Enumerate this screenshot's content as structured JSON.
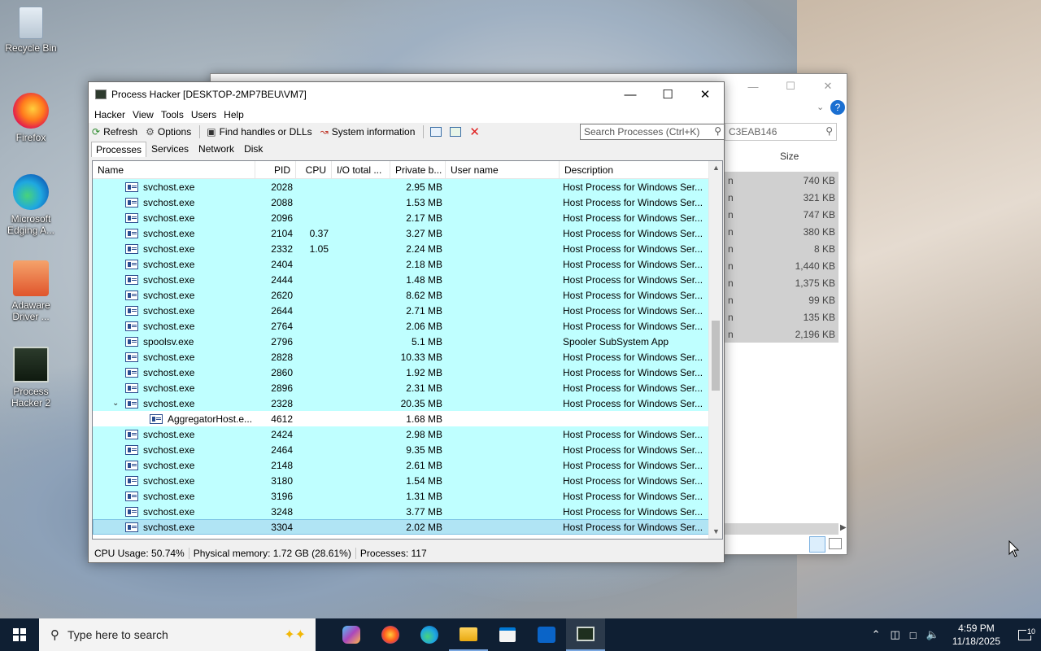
{
  "desktop": {
    "icons": [
      {
        "label": "Recycle Bin"
      },
      {
        "label": "Firefox"
      },
      {
        "label": "Microsoft Edging A..."
      },
      {
        "label": "Adaware Driver ..."
      },
      {
        "label": "Process Hacker 2"
      }
    ]
  },
  "bg_window": {
    "search_text": "C3EAB146",
    "size_header": "Size",
    "sizes": [
      "740 KB",
      "321 KB",
      "747 KB",
      "380 KB",
      "8 KB",
      "1,440 KB",
      "1,375 KB",
      "99 KB",
      "135 KB",
      "2,196 KB"
    ],
    "row_prefix": "n"
  },
  "window": {
    "title": "Process Hacker [DESKTOP-2MP7BEU\\VM7]",
    "menu": [
      "Hacker",
      "View",
      "Tools",
      "Users",
      "Help"
    ],
    "toolbar": {
      "refresh": "Refresh",
      "options": "Options",
      "find_handles": "Find handles or DLLs",
      "system_info": "System information"
    },
    "search_placeholder": "Search Processes (Ctrl+K)",
    "tabs": [
      "Processes",
      "Services",
      "Network",
      "Disk"
    ],
    "columns": [
      "Name",
      "PID",
      "CPU",
      "I/O total ...",
      "Private b...",
      "User name",
      "Description"
    ],
    "rows": [
      {
        "name": "svchost.exe",
        "pid": "2028",
        "cpu": "",
        "pb": "2.95 MB",
        "desc": "Host Process for Windows Ser...",
        "indent": 1,
        "style": "svc"
      },
      {
        "name": "svchost.exe",
        "pid": "2088",
        "cpu": "",
        "pb": "1.53 MB",
        "desc": "Host Process for Windows Ser...",
        "indent": 1,
        "style": "svc"
      },
      {
        "name": "svchost.exe",
        "pid": "2096",
        "cpu": "",
        "pb": "2.17 MB",
        "desc": "Host Process for Windows Ser...",
        "indent": 1,
        "style": "svc"
      },
      {
        "name": "svchost.exe",
        "pid": "2104",
        "cpu": "0.37",
        "pb": "3.27 MB",
        "desc": "Host Process for Windows Ser...",
        "indent": 1,
        "style": "svc"
      },
      {
        "name": "svchost.exe",
        "pid": "2332",
        "cpu": "1.05",
        "pb": "2.24 MB",
        "desc": "Host Process for Windows Ser...",
        "indent": 1,
        "style": "svc"
      },
      {
        "name": "svchost.exe",
        "pid": "2404",
        "cpu": "",
        "pb": "2.18 MB",
        "desc": "Host Process for Windows Ser...",
        "indent": 1,
        "style": "svc"
      },
      {
        "name": "svchost.exe",
        "pid": "2444",
        "cpu": "",
        "pb": "1.48 MB",
        "desc": "Host Process for Windows Ser...",
        "indent": 1,
        "style": "svc"
      },
      {
        "name": "svchost.exe",
        "pid": "2620",
        "cpu": "",
        "pb": "8.62 MB",
        "desc": "Host Process for Windows Ser...",
        "indent": 1,
        "style": "svc"
      },
      {
        "name": "svchost.exe",
        "pid": "2644",
        "cpu": "",
        "pb": "2.71 MB",
        "desc": "Host Process for Windows Ser...",
        "indent": 1,
        "style": "svc"
      },
      {
        "name": "svchost.exe",
        "pid": "2764",
        "cpu": "",
        "pb": "2.06 MB",
        "desc": "Host Process for Windows Ser...",
        "indent": 1,
        "style": "svc"
      },
      {
        "name": "spoolsv.exe",
        "pid": "2796",
        "cpu": "",
        "pb": "5.1 MB",
        "desc": "Spooler SubSystem App",
        "indent": 1,
        "style": "svc"
      },
      {
        "name": "svchost.exe",
        "pid": "2828",
        "cpu": "",
        "pb": "10.33 MB",
        "desc": "Host Process for Windows Ser...",
        "indent": 1,
        "style": "svc"
      },
      {
        "name": "svchost.exe",
        "pid": "2860",
        "cpu": "",
        "pb": "1.92 MB",
        "desc": "Host Process for Windows Ser...",
        "indent": 1,
        "style": "svc"
      },
      {
        "name": "svchost.exe",
        "pid": "2896",
        "cpu": "",
        "pb": "2.31 MB",
        "desc": "Host Process for Windows Ser...",
        "indent": 1,
        "style": "svc"
      },
      {
        "name": "svchost.exe",
        "pid": "2328",
        "cpu": "",
        "pb": "20.35 MB",
        "desc": "Host Process for Windows Ser...",
        "indent": 1,
        "style": "svc",
        "expanded": true
      },
      {
        "name": "AggregatorHost.e...",
        "pid": "4612",
        "cpu": "",
        "pb": "1.68 MB",
        "desc": "",
        "indent": 2,
        "style": "white"
      },
      {
        "name": "svchost.exe",
        "pid": "2424",
        "cpu": "",
        "pb": "2.98 MB",
        "desc": "Host Process for Windows Ser...",
        "indent": 1,
        "style": "svc"
      },
      {
        "name": "svchost.exe",
        "pid": "2464",
        "cpu": "",
        "pb": "9.35 MB",
        "desc": "Host Process for Windows Ser...",
        "indent": 1,
        "style": "svc"
      },
      {
        "name": "svchost.exe",
        "pid": "2148",
        "cpu": "",
        "pb": "2.61 MB",
        "desc": "Host Process for Windows Ser...",
        "indent": 1,
        "style": "svc"
      },
      {
        "name": "svchost.exe",
        "pid": "3180",
        "cpu": "",
        "pb": "1.54 MB",
        "desc": "Host Process for Windows Ser...",
        "indent": 1,
        "style": "svc"
      },
      {
        "name": "svchost.exe",
        "pid": "3196",
        "cpu": "",
        "pb": "1.31 MB",
        "desc": "Host Process for Windows Ser...",
        "indent": 1,
        "style": "svc"
      },
      {
        "name": "svchost.exe",
        "pid": "3248",
        "cpu": "",
        "pb": "3.77 MB",
        "desc": "Host Process for Windows Ser...",
        "indent": 1,
        "style": "svc"
      },
      {
        "name": "svchost.exe",
        "pid": "3304",
        "cpu": "",
        "pb": "2.02 MB",
        "desc": "Host Process for Windows Ser...",
        "indent": 1,
        "style": "sel"
      }
    ],
    "status": {
      "cpu": "CPU Usage: 50.74%",
      "memory": "Physical memory: 1.72 GB (28.61%)",
      "processes": "Processes: 117"
    }
  },
  "taskbar": {
    "search_placeholder": "Type here to search",
    "time": "4:59 PM",
    "date": "11/18/2025",
    "notifications": "10"
  },
  "colors": {
    "service_row": "#bfffff",
    "selected_row": "#b0e4f4",
    "taskbar": "#0f1f33"
  }
}
